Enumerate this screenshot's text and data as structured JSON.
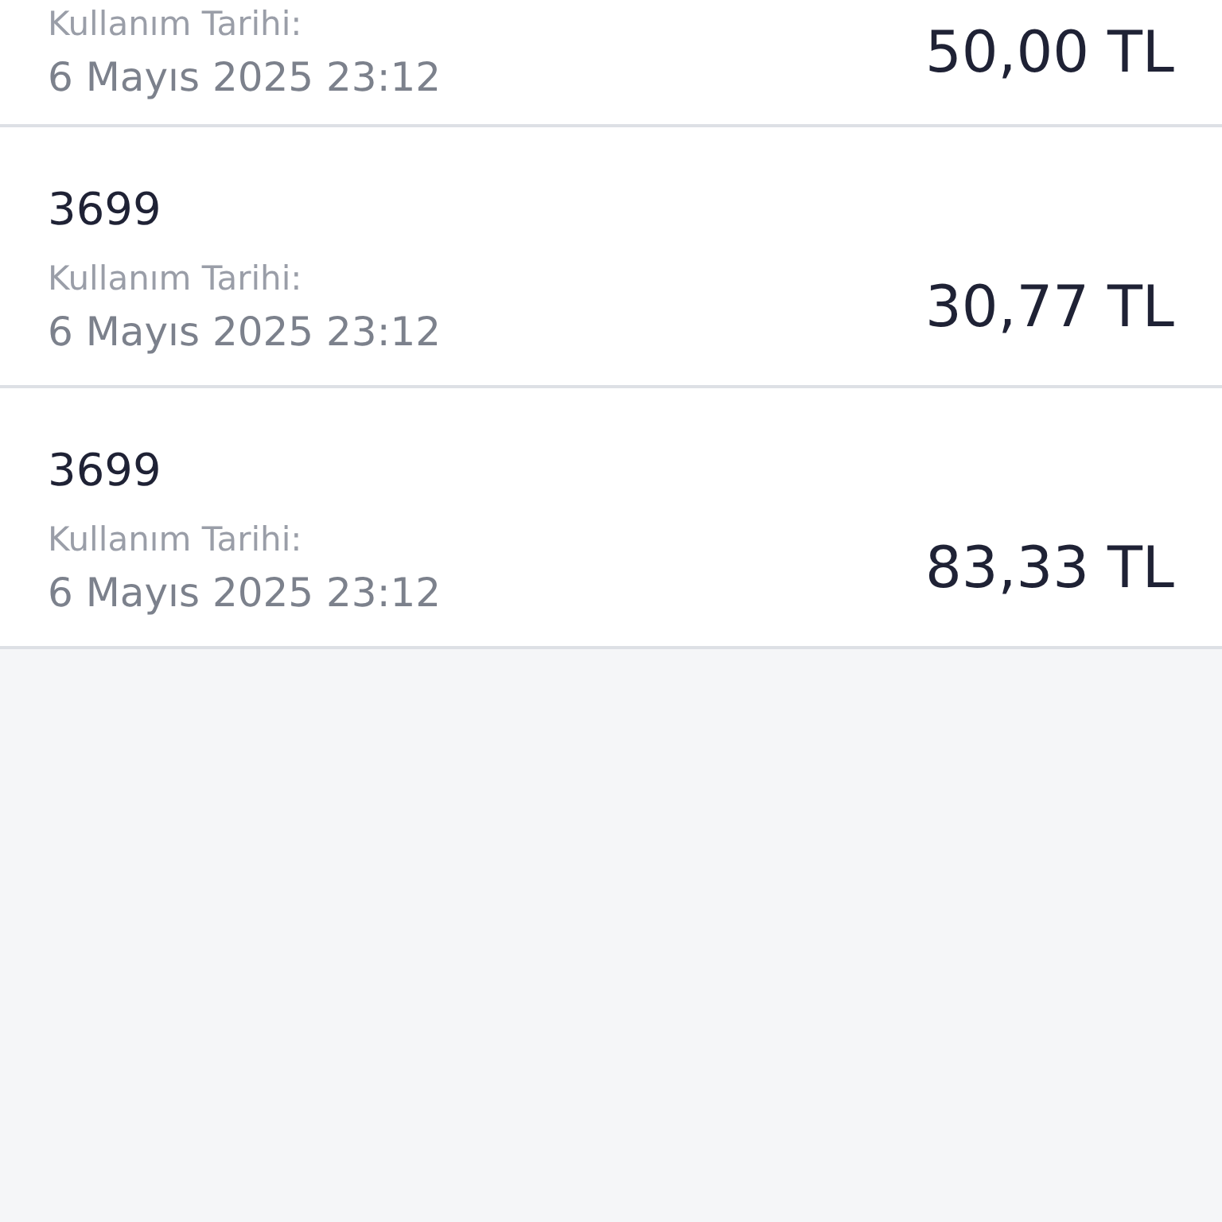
{
  "transactions": [
    {
      "label": "Kullanım Tarihi:",
      "date": "6 Mayıs 2025 23:12",
      "amount": "50,00 TL"
    },
    {
      "code": "3699",
      "label": "Kullanım Tarihi:",
      "date": "6 Mayıs 2025 23:12",
      "amount": "30,77 TL"
    },
    {
      "code": "3699",
      "label": "Kullanım Tarihi:",
      "date": "6 Mayıs 2025 23:12",
      "amount": "83,33 TL"
    }
  ]
}
